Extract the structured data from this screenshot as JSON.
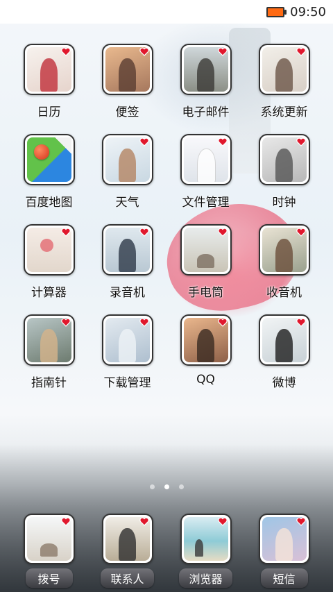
{
  "status_bar": {
    "time": "09:50",
    "battery_color": "#ff6a13"
  },
  "apps": [
    {
      "label": "日历",
      "icon": "calendar-photo-icon"
    },
    {
      "label": "便签",
      "icon": "notes-photo-icon"
    },
    {
      "label": "电子邮件",
      "icon": "email-photo-icon"
    },
    {
      "label": "系统更新",
      "icon": "system-update-photo-icon"
    },
    {
      "label": "百度地图",
      "icon": "baidu-map-icon"
    },
    {
      "label": "天气",
      "icon": "weather-photo-icon"
    },
    {
      "label": "文件管理",
      "icon": "file-manager-photo-icon"
    },
    {
      "label": "时钟",
      "icon": "clock-photo-icon"
    },
    {
      "label": "计算器",
      "icon": "calculator-photo-icon"
    },
    {
      "label": "录音机",
      "icon": "recorder-photo-icon"
    },
    {
      "label": "手电筒",
      "icon": "flashlight-photo-icon"
    },
    {
      "label": "收音机",
      "icon": "radio-photo-icon"
    },
    {
      "label": "指南针",
      "icon": "compass-photo-icon"
    },
    {
      "label": "下载管理",
      "icon": "download-manager-photo-icon"
    },
    {
      "label": "QQ",
      "icon": "qq-photo-icon"
    },
    {
      "label": "微博",
      "icon": "weibo-photo-icon"
    }
  ],
  "page_indicator": {
    "pages": 3,
    "active": 2
  },
  "dock": [
    {
      "label": "拨号",
      "icon": "dialer-photo-icon"
    },
    {
      "label": "联系人",
      "icon": "contacts-photo-icon"
    },
    {
      "label": "浏览器",
      "icon": "browser-photo-icon"
    },
    {
      "label": "短信",
      "icon": "messages-photo-icon"
    }
  ],
  "colors": {
    "badge_heart": "#e0182d",
    "icon_border": "#333333"
  }
}
